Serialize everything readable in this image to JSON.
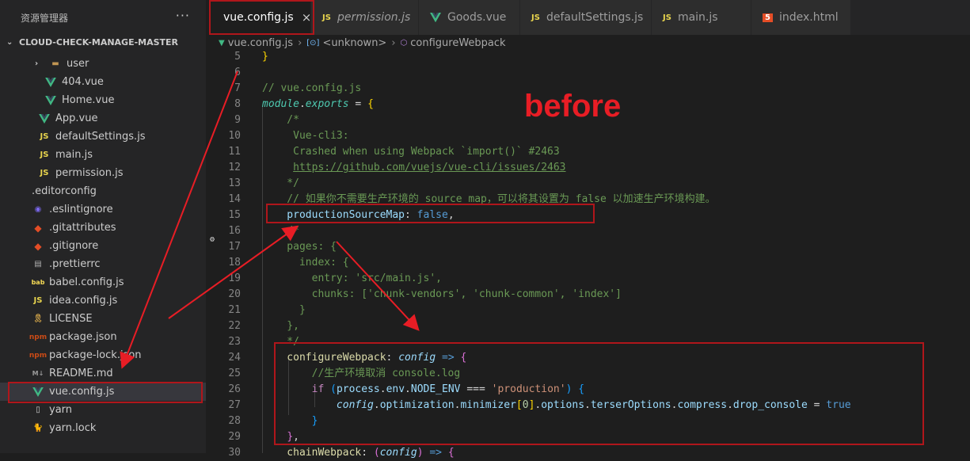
{
  "sidebar": {
    "title": "资源管理器",
    "more_label": "···",
    "project": "CLOUD-CHECK-MANAGE-MASTER",
    "items": [
      {
        "label": "user",
        "icon": "folder-icon",
        "glyph": "▬",
        "cls": "folder",
        "indent": 40,
        "chev": "›"
      },
      {
        "label": "404.vue",
        "icon": "vue-icon",
        "glyph": "",
        "cls": "vue",
        "indent": 56
      },
      {
        "label": "Home.vue",
        "icon": "vue-icon",
        "glyph": "",
        "cls": "vue",
        "indent": 56
      },
      {
        "label": "App.vue",
        "icon": "vue-icon",
        "glyph": "",
        "cls": "vue",
        "indent": 48
      },
      {
        "label": "defaultSettings.js",
        "icon": "js-icon",
        "glyph": "JS",
        "cls": "js",
        "indent": 48
      },
      {
        "label": "main.js",
        "icon": "js-icon",
        "glyph": "JS",
        "cls": "js",
        "indent": 48
      },
      {
        "label": "permission.js",
        "icon": "js-icon",
        "glyph": "JS",
        "cls": "js",
        "indent": 48
      },
      {
        "label": ".editorconfig",
        "icon": "editorconfig-icon",
        "glyph": "⚙",
        "cls": "editor",
        "indent": 40
      },
      {
        "label": ".eslintignore",
        "icon": "eslint-icon",
        "glyph": "◉",
        "cls": "eslint",
        "indent": 40
      },
      {
        "label": ".gitattributes",
        "icon": "git-icon",
        "glyph": "◆",
        "cls": "git",
        "indent": 40
      },
      {
        "label": ".gitignore",
        "icon": "git-icon",
        "glyph": "◆",
        "cls": "git",
        "indent": 40
      },
      {
        "label": ".prettierrc",
        "icon": "prettier-icon",
        "glyph": "▤",
        "cls": "prettier",
        "indent": 40
      },
      {
        "label": "babel.config.js",
        "icon": "babel-icon",
        "glyph": "bab",
        "cls": "babel",
        "indent": 40
      },
      {
        "label": "idea.config.js",
        "icon": "js-icon",
        "glyph": "JS",
        "cls": "js",
        "indent": 40
      },
      {
        "label": "LICENSE",
        "icon": "license-icon",
        "glyph": "🎗",
        "cls": "license",
        "indent": 40
      },
      {
        "label": "package.json",
        "icon": "npm-icon",
        "glyph": "npm",
        "cls": "json",
        "indent": 40
      },
      {
        "label": "package-lock.json",
        "icon": "npm-icon",
        "glyph": "npm",
        "cls": "json",
        "indent": 40
      },
      {
        "label": "README.md",
        "icon": "markdown-icon",
        "glyph": "M↓",
        "cls": "md",
        "indent": 40
      },
      {
        "label": "vue.config.js",
        "icon": "vue-config-icon",
        "glyph": "",
        "cls": "vue",
        "indent": 40,
        "selected": true
      },
      {
        "label": "yarn",
        "icon": "file-icon",
        "glyph": "▯",
        "cls": "file",
        "indent": 40
      },
      {
        "label": "yarn.lock",
        "icon": "yarn-icon",
        "glyph": "🐈",
        "cls": "yarn",
        "indent": 40
      }
    ]
  },
  "tabs": [
    {
      "label": "vue.config.js",
      "icon": "vue-config-icon",
      "active": true,
      "close": "×"
    },
    {
      "label": "permission.js",
      "icon": "js-icon",
      "italic": true
    },
    {
      "label": "Goods.vue",
      "icon": "vue-icon"
    },
    {
      "label": "defaultSettings.js",
      "icon": "js-icon"
    },
    {
      "label": "main.js",
      "icon": "js-icon"
    },
    {
      "label": "index.html",
      "icon": "html5-icon"
    }
  ],
  "breadcrumb": {
    "file": "vue.config.js",
    "symbol1": "<unknown>",
    "symbol2": "configureWebpack"
  },
  "annotation": {
    "text": "before",
    "color": "#e81d25"
  },
  "code_lines": [
    {
      "n": "5",
      "tokens": [
        [
          "c-br1",
          "}"
        ]
      ]
    },
    {
      "n": "6",
      "tokens": []
    },
    {
      "n": "7",
      "tokens": [
        [
          "c-com",
          "// vue.config.js"
        ]
      ]
    },
    {
      "n": "8",
      "tokens": [
        [
          "c-mod",
          "module"
        ],
        [
          "c-punc",
          "."
        ],
        [
          "c-mod",
          "exports"
        ],
        [
          "c-op",
          " = "
        ],
        [
          "c-br1",
          "{"
        ]
      ]
    },
    {
      "n": "9",
      "tokens": [
        [
          "c-com",
          "    /*"
        ]
      ]
    },
    {
      "n": "10",
      "tokens": [
        [
          "c-com",
          "     Vue-cli3:"
        ]
      ]
    },
    {
      "n": "11",
      "tokens": [
        [
          "c-com",
          "     Crashed when using Webpack `import()` #2463"
        ]
      ]
    },
    {
      "n": "12",
      "tokens": [
        [
          "c-com",
          "     "
        ],
        [
          "c-link",
          "https://github.com/vuejs/vue-cli/issues/2463"
        ]
      ]
    },
    {
      "n": "13",
      "tokens": [
        [
          "c-com",
          "    */"
        ]
      ]
    },
    {
      "n": "14",
      "tokens": [
        [
          "c-com",
          "    // 如果你不需要生产环境的 source map，可以将其设置为 false 以加速生产环境构建。"
        ]
      ]
    },
    {
      "n": "15",
      "tokens": [
        [
          "c-prop",
          "    productionSourceMap"
        ],
        [
          "c-punc",
          ": "
        ],
        [
          "c-bool",
          "false"
        ],
        [
          "c-punc",
          ","
        ]
      ]
    },
    {
      "n": "16",
      "tokens": [
        [
          "c-com",
          "    /*"
        ]
      ]
    },
    {
      "n": "17",
      "tokens": [
        [
          "c-com",
          "    pages: {"
        ]
      ]
    },
    {
      "n": "18",
      "tokens": [
        [
          "c-com",
          "      index: {"
        ]
      ]
    },
    {
      "n": "19",
      "tokens": [
        [
          "c-com",
          "        entry: 'src/main.js',"
        ]
      ]
    },
    {
      "n": "20",
      "tokens": [
        [
          "c-com",
          "        chunks: ['chunk-vendors', 'chunk-common', 'index']"
        ]
      ]
    },
    {
      "n": "21",
      "tokens": [
        [
          "c-com",
          "      }"
        ]
      ]
    },
    {
      "n": "22",
      "tokens": [
        [
          "c-com",
          "    },"
        ]
      ]
    },
    {
      "n": "23",
      "tokens": [
        [
          "c-com",
          "    */"
        ]
      ]
    },
    {
      "n": "24",
      "tokens": [
        [
          "c-fn",
          "    configureWebpack"
        ],
        [
          "c-punc",
          ": "
        ],
        [
          "c-varit",
          "config"
        ],
        [
          "c-bool",
          " => "
        ],
        [
          "c-br2",
          "{"
        ]
      ]
    },
    {
      "n": "25",
      "tokens": [
        [
          "c-com",
          "        //生产环境取消 console.log"
        ]
      ]
    },
    {
      "n": "26",
      "tokens": [
        [
          "c-kw",
          "        if"
        ],
        [
          "c-punc",
          " "
        ],
        [
          "c-br3",
          "("
        ],
        [
          "c-var",
          "process"
        ],
        [
          "c-punc",
          "."
        ],
        [
          "c-var",
          "env"
        ],
        [
          "c-punc",
          "."
        ],
        [
          "c-var",
          "NODE_ENV"
        ],
        [
          "c-op",
          " === "
        ],
        [
          "c-str",
          "'production'"
        ],
        [
          "c-br3",
          ")"
        ],
        [
          "c-punc",
          " "
        ],
        [
          "c-br3",
          "{"
        ]
      ]
    },
    {
      "n": "27",
      "tokens": [
        [
          "c-varit",
          "            config"
        ],
        [
          "c-punc",
          "."
        ],
        [
          "c-var",
          "optimization"
        ],
        [
          "c-punc",
          "."
        ],
        [
          "c-var",
          "minimizer"
        ],
        [
          "c-br1",
          "["
        ],
        [
          "c-num",
          "0"
        ],
        [
          "c-br1",
          "]"
        ],
        [
          "c-punc",
          "."
        ],
        [
          "c-var",
          "options"
        ],
        [
          "c-punc",
          "."
        ],
        [
          "c-var",
          "terserOptions"
        ],
        [
          "c-punc",
          "."
        ],
        [
          "c-var",
          "compress"
        ],
        [
          "c-punc",
          "."
        ],
        [
          "c-var",
          "drop_console"
        ],
        [
          "c-op",
          " = "
        ],
        [
          "c-bool",
          "true"
        ]
      ]
    },
    {
      "n": "28",
      "tokens": [
        [
          "c-br3",
          "        }"
        ]
      ]
    },
    {
      "n": "29",
      "tokens": [
        [
          "c-white",
          "    "
        ],
        [
          "c-br2",
          "}"
        ],
        [
          "c-punc",
          ","
        ]
      ]
    },
    {
      "n": "30",
      "tokens": [
        [
          "c-fn",
          "    chainWebpack"
        ],
        [
          "c-punc",
          ": "
        ],
        [
          "c-br2",
          "("
        ],
        [
          "c-varit",
          "config"
        ],
        [
          "c-br2",
          ")"
        ],
        [
          "c-bool",
          " => "
        ],
        [
          "c-br2",
          "{"
        ]
      ]
    }
  ]
}
